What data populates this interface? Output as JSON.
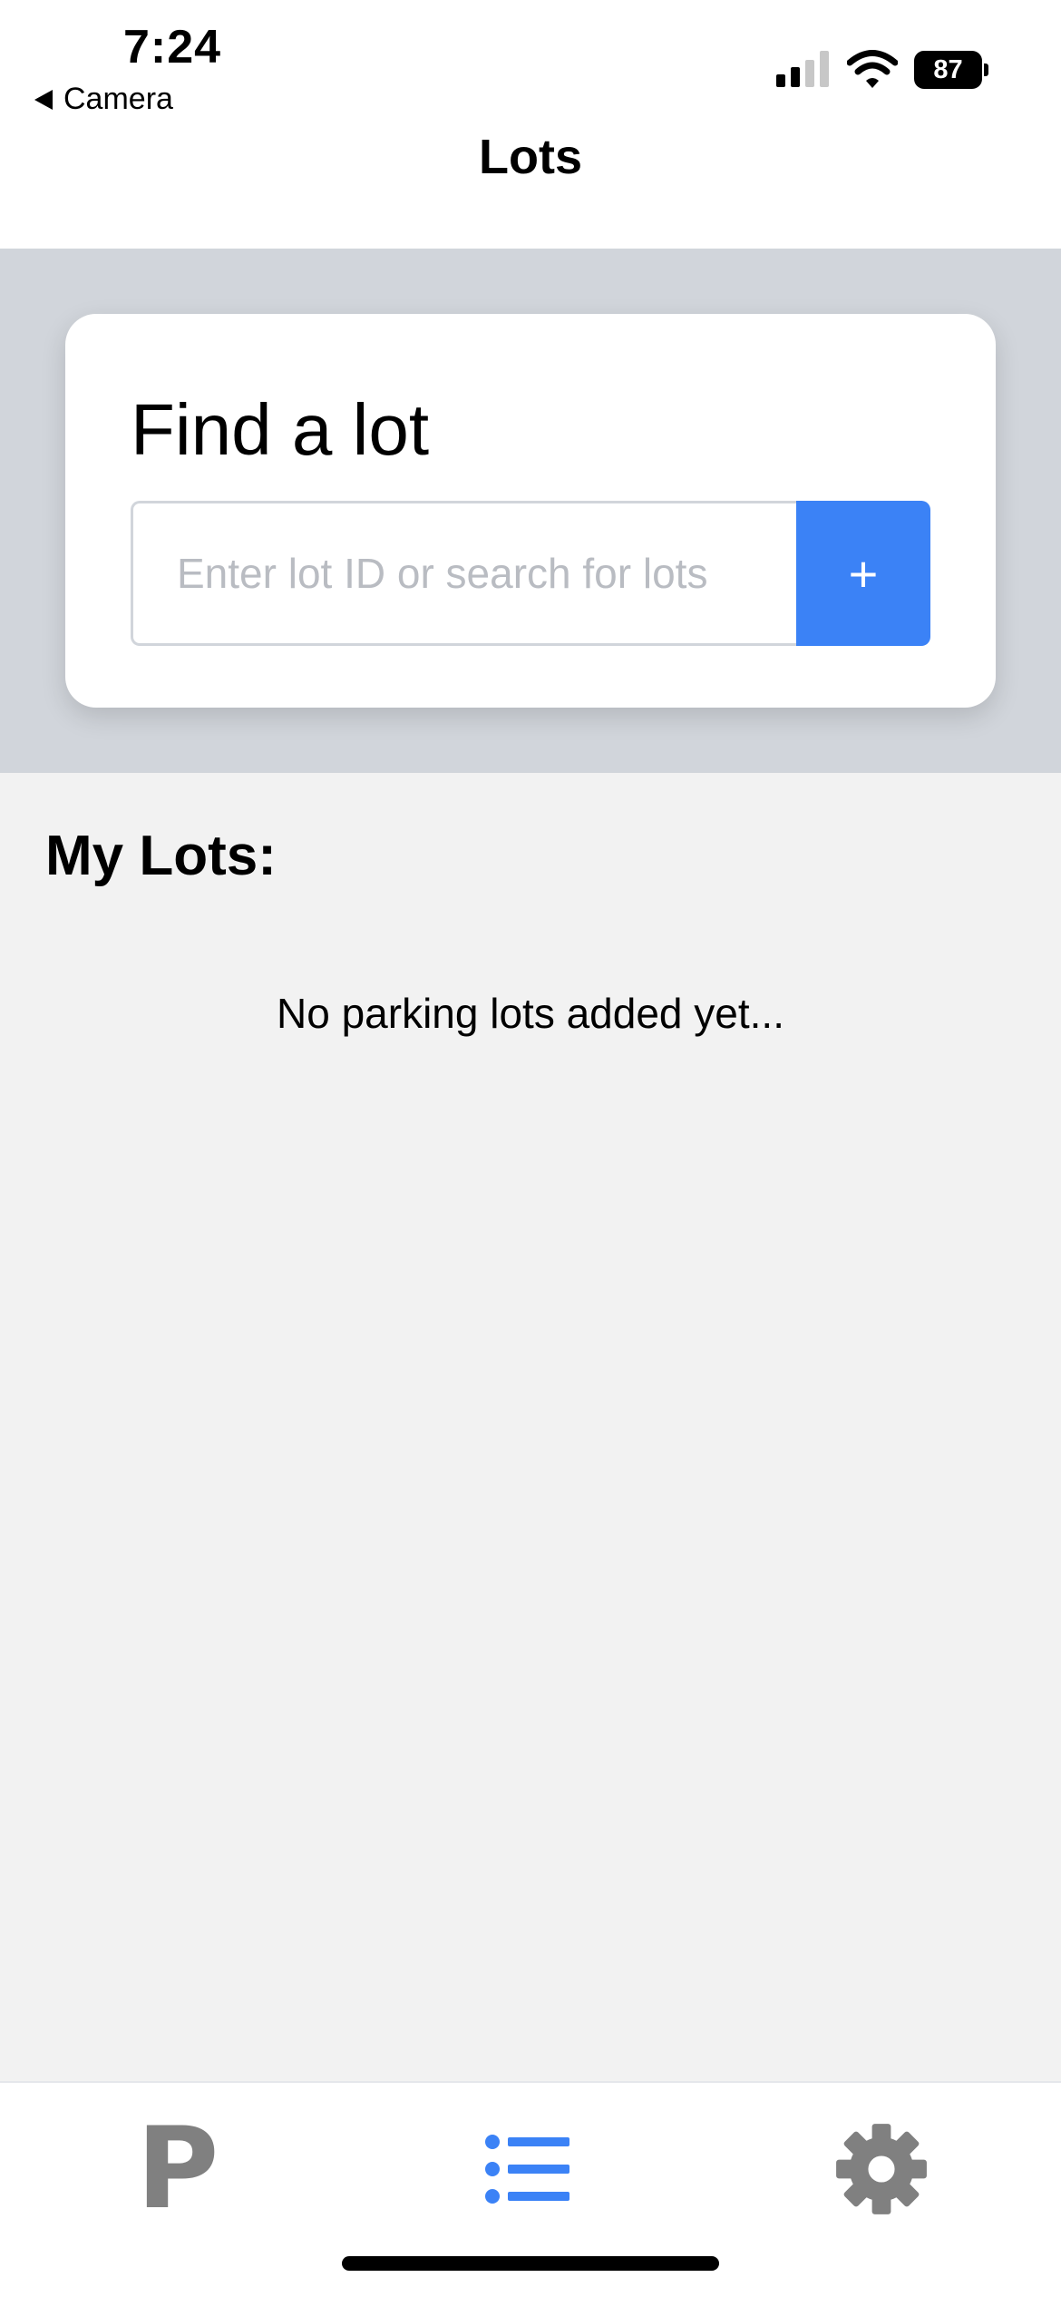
{
  "status_bar": {
    "time": "7:24",
    "back_label": "Camera",
    "battery_level": "87"
  },
  "nav": {
    "title": "Lots"
  },
  "search_card": {
    "title": "Find a lot",
    "input_value": "",
    "input_placeholder": "Enter lot ID or search for lots",
    "add_button_label": "+"
  },
  "my_lots": {
    "heading": "My Lots:",
    "empty_message": "No parking lots added yet..."
  },
  "tab_bar": {
    "tabs": [
      {
        "icon": "parking-icon",
        "glyph": "P",
        "active": false
      },
      {
        "icon": "list-icon",
        "active": true
      },
      {
        "icon": "gear-icon",
        "active": false
      }
    ]
  },
  "colors": {
    "accent": "#3b82f6",
    "hero_background": "#d1d5db",
    "page_background": "#f2f2f2",
    "inactive_icon": "#808080"
  }
}
